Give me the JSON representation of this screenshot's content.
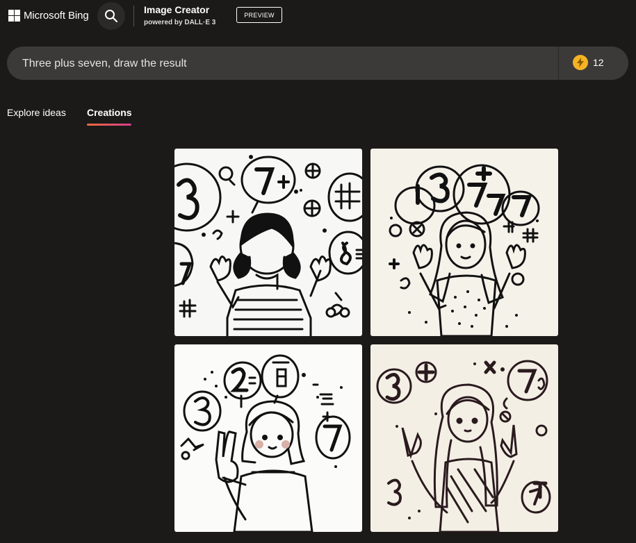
{
  "header": {
    "brand": "Microsoft Bing",
    "app_title": "Image Creator",
    "app_subtitle": "powered by DALL·E 3",
    "preview_label": "PREVIEW"
  },
  "prompt": {
    "value": "Three plus seven, draw the result",
    "boost_count": "12"
  },
  "tabs": {
    "explore": "Explore ideas",
    "creations": "Creations",
    "active": "creations"
  },
  "images": [
    {
      "style": "girl with bangs and pigtails in striped shirt, bubbles with 3, 7+, 8"
    },
    {
      "style": "long-haired girl in dotted sweater, bubbles with 1 3 = 3 + 7 7"
    },
    {
      "style": "girl with bob haircut in sweater, bubbles with 2=, 3, 7, x=8"
    },
    {
      "style": "wavy-haired girl in dress, bubbles with 3, +, 7, %"
    }
  ],
  "colors": {
    "background": "#1b1a19",
    "prompt_bar": "#3b3a39",
    "tab_underline_start": "#f06a3c",
    "tab_underline_end": "#d63f8c",
    "boost_coin": "#f5b324"
  }
}
